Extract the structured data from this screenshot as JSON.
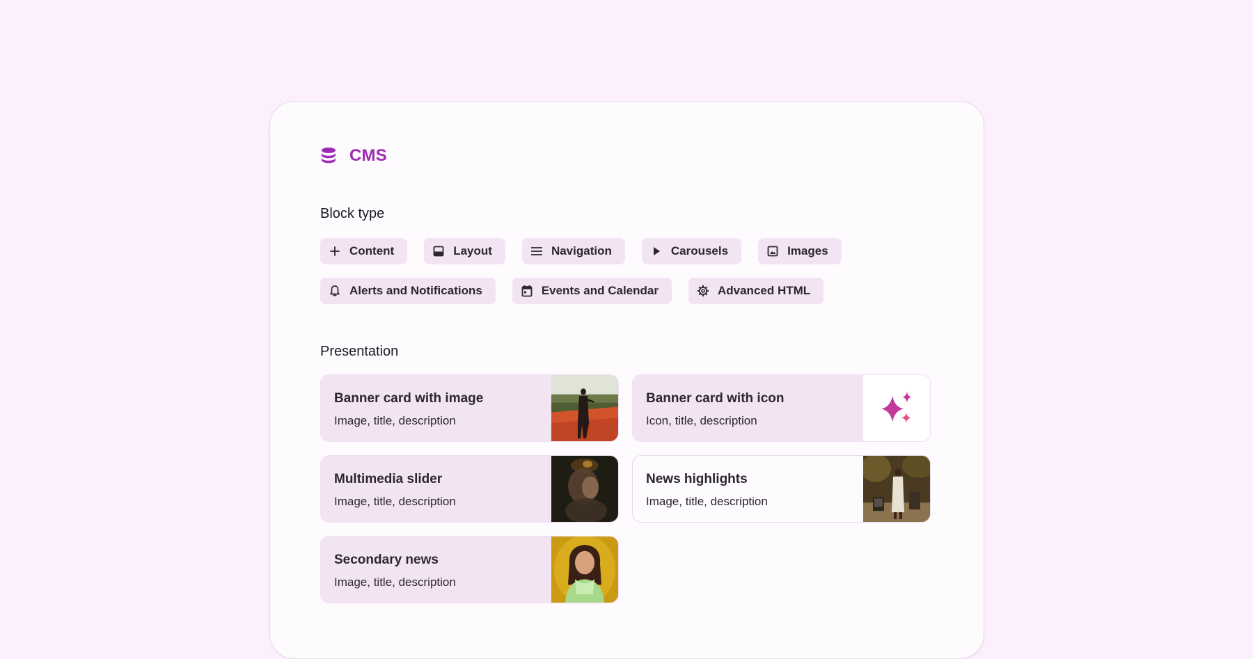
{
  "header": {
    "brand": "CMS",
    "icon": "database-icon"
  },
  "block_type": {
    "label": "Block type",
    "chips": [
      {
        "label": "Content",
        "icon": "plus-icon"
      },
      {
        "label": "Layout",
        "icon": "layout-icon"
      },
      {
        "label": "Navigation",
        "icon": "menu-icon"
      },
      {
        "label": "Carousels",
        "icon": "play-icon"
      },
      {
        "label": "Images",
        "icon": "image-icon"
      },
      {
        "label": "Alerts and Notifications",
        "icon": "bell-icon"
      },
      {
        "label": "Events and Calendar",
        "icon": "calendar-icon"
      },
      {
        "label": "Advanced HTML",
        "icon": "gear-icon"
      }
    ]
  },
  "presentation": {
    "label": "Presentation",
    "cards": [
      {
        "title": "Banner card with image",
        "description": "Image, title, description",
        "thumbnail": "photo-person-on-track"
      },
      {
        "title": "Banner card with icon",
        "description": "Icon, title, description",
        "thumbnail": "sparkle-icon"
      },
      {
        "title": "Multimedia slider",
        "description": "Image, title, description",
        "thumbnail": "photo-blurred-portrait"
      },
      {
        "title": "News highlights",
        "description": "Image, title, description",
        "thumbnail": "photo-person-with-tv"
      },
      {
        "title": "Secondary news",
        "description": "Image, title, description",
        "thumbnail": "photo-woman-scarf"
      }
    ]
  },
  "colors": {
    "accent": "#9e2bb5",
    "chip_bg": "#f3e4f3",
    "page_bg": "#fdf0fd",
    "sparkle": "#c2399b"
  }
}
